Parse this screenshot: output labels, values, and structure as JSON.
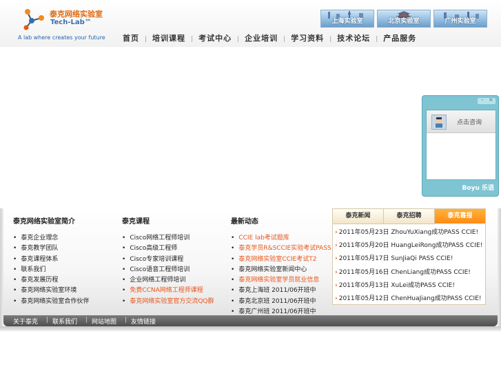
{
  "logo": {
    "cn_name": "泰克网络实验室",
    "en_name": "Tech-Lab™",
    "slogan": "A lab where creates your future"
  },
  "lab_banners": [
    "上海实验室",
    "北京实验室",
    "广州实验室"
  ],
  "nav": [
    "首页",
    "培训课程",
    "考试中心",
    "企业培训",
    "学习资料",
    "技术论坛",
    "产品服务"
  ],
  "chat": {
    "label": "点击咨询",
    "brand": "Boyu 乐语"
  },
  "columns": [
    {
      "title": "泰克网络实验室简介",
      "items": [
        {
          "text": "泰克企业理念",
          "hot": false
        },
        {
          "text": "泰克教学团队",
          "hot": false
        },
        {
          "text": "泰克课程体系",
          "hot": false
        },
        {
          "text": "联系我们",
          "hot": false
        },
        {
          "text": "泰克发展历程",
          "hot": false
        },
        {
          "text": "泰克网络实验室环境",
          "hot": false
        },
        {
          "text": "泰克网络实验室合作伙伴",
          "hot": false
        }
      ]
    },
    {
      "title": "泰克课程",
      "items": [
        {
          "text": "Cisco网络工程师培训",
          "hot": false
        },
        {
          "text": "Cisco高级工程师",
          "hot": false
        },
        {
          "text": "Cisco专家培训课程",
          "hot": false
        },
        {
          "text": "Cisco语音工程师培训",
          "hot": false
        },
        {
          "text": "企业网络工程师培训",
          "hot": false
        },
        {
          "text": "免费CCNA网络工程师课程",
          "hot": true
        },
        {
          "text": "泰克网络实验室官方交流QQ群",
          "hot": true
        }
      ]
    },
    {
      "title": "最新动态",
      "items": [
        {
          "text": "CCIE lab考试题库",
          "hot": true
        },
        {
          "text": "泰克学员R&SCCIE实验考试PASS",
          "hot": true
        },
        {
          "text": "泰克网络实验室CCIE考试T2",
          "hot": true
        },
        {
          "text": "泰克网络实验室新闻中心",
          "hot": false
        },
        {
          "text": "泰克网络实验室学员就业信息",
          "hot": true
        },
        {
          "text": "泰克上海班 2011/06开班中",
          "hot": false
        },
        {
          "text": "泰克北京班 2011/06开班中",
          "hot": false
        },
        {
          "text": "泰克广州班 2011/06开班中",
          "hot": false
        }
      ]
    }
  ],
  "tabs": [
    "泰克新闻",
    "泰克招聘",
    "泰克喜报"
  ],
  "news": [
    "2011年05月23日 ZhouYuXiang成功PASS CCIE!",
    "2011年05月20日 HuangLeiRong成功PASS CCIE!",
    "2011年05月17日 SunJiaQi PASS CCIE!",
    "2011年05月16日 ChenLiang成功PASS CCIE!",
    "2011年05月13日 XuLei成功PASS CCIE!",
    "2011年05月12日 ChenHuaJiang成功PASS CCIE!"
  ],
  "footer_links": [
    "关于泰克",
    "联系我们",
    "网站地图",
    "友情链接"
  ],
  "colors": {
    "accent": "#ff8a12",
    "hot_link": "#e8551c",
    "nav_text": "#333333",
    "chat": "#7fc4d3"
  },
  "icons": [
    "tech-lab-logo-icon",
    "chat-avatar-icon",
    "arrow-right-icon",
    "minimize-icon",
    "close-icon"
  ]
}
